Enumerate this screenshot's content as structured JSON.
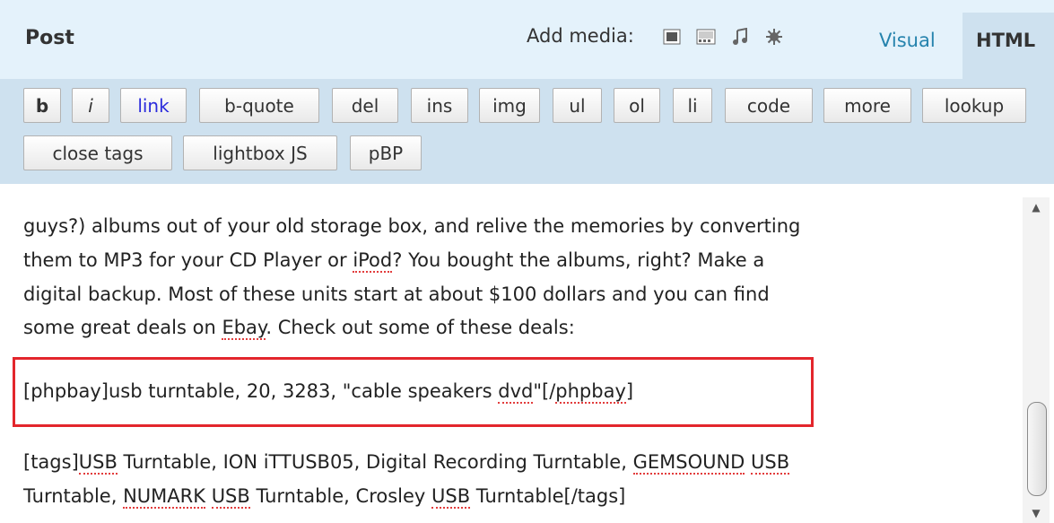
{
  "header": {
    "title": "Post",
    "add_media_label": "Add media:",
    "media_icons": [
      "image-icon",
      "video-icon",
      "audio-icon",
      "media-icon"
    ],
    "tabs": {
      "visual": "Visual",
      "html": "HTML"
    }
  },
  "toolbar": {
    "buttons": [
      "b",
      "i",
      "link",
      "b-quote",
      "del",
      "ins",
      "img",
      "ul",
      "ol",
      "li",
      "code",
      "more",
      "lookup",
      "close tags",
      "lightbox JS",
      "pBP"
    ]
  },
  "editor": {
    "line1": "guys?) albums out of your old storage box, and relive the memories by converting",
    "line2_a": "them to MP3 for your CD Player or ",
    "line2_b": "iPod",
    "line2_c": "?  You bought the albums, right?  Make a",
    "line3": "digital backup.  Most of these units start at about $100 dollars and you can find",
    "line4_a": "some great deals on ",
    "line4_b": "Ebay",
    "line4_c": ".  Check out some of these deals:",
    "phpbay_a": "[phpbay]usb turntable, 20, 3283, \"cable speakers ",
    "phpbay_b": "dvd",
    "phpbay_c": "\"[/",
    "phpbay_d": "phpbay",
    "phpbay_e": "]",
    "tags1_a": "[tags]",
    "tags1_b": "USB",
    "tags1_c": " Turntable, ION iTTUSB05, Digital Recording Turntable, ",
    "tags1_d": "GEMSOUND",
    "tags1_e": " ",
    "tags1_f": "USB",
    "tags2_a": "Turntable, ",
    "tags2_b": "NUMARK",
    "tags2_c": " ",
    "tags2_d": "USB",
    "tags2_e": " Turntable, Crosley ",
    "tags2_f": "USB",
    "tags2_g": " Turntable[/tags]"
  },
  "colors": {
    "accent": "#2583ad",
    "highlight_border": "#e3262c",
    "toolbar_bg": "#cee1ef",
    "header_bg": "#e4f2fb"
  }
}
